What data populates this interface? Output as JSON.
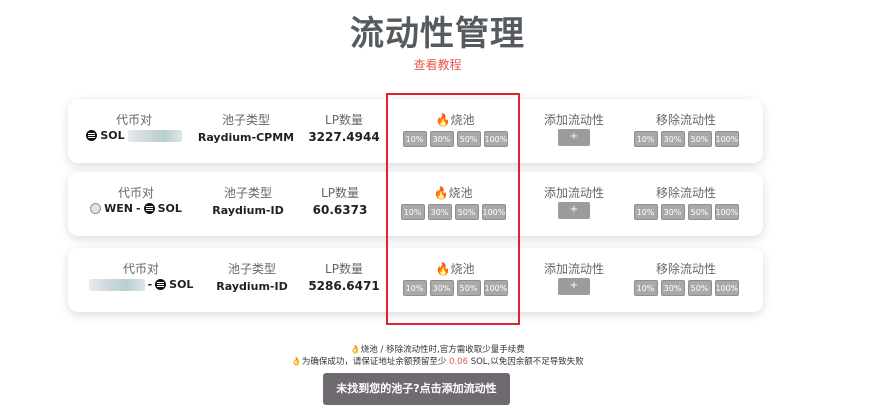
{
  "header": {
    "title": "流动性管理",
    "tutorial_link": "查看教程"
  },
  "labels": {
    "pair": "代币对",
    "pool_type": "池子类型",
    "lp_amount": "LP数量",
    "burn_pool": "烧池",
    "add_liquidity": "添加流动性",
    "remove_liquidity": "移除流动性",
    "add_symbol": "+",
    "dash": "-"
  },
  "percent_options": [
    "10%",
    "30%",
    "50%",
    "100%"
  ],
  "pools": [
    {
      "token_a": "SOL",
      "token_b": "",
      "pool_type": "Raydium-CPMM",
      "lp_amount": "3227.4944"
    },
    {
      "token_a": "WEN",
      "token_b": "SOL",
      "pool_type": "Raydium-ID",
      "lp_amount": "60.6373"
    },
    {
      "token_a": "",
      "token_b": "SOL",
      "pool_type": "Raydium-ID",
      "lp_amount": "5286.6471"
    }
  ],
  "notes": {
    "line1": "烧池 / 移除流动性时,官方需收取少量手续费",
    "line2_prefix": "为确保成功，请保证地址余额预留至少",
    "line2_amount": "0.06",
    "line2_suffix": "SOL,以免因余额不足导致失败"
  },
  "cta_label": "未找到您的池子?点击添加流动性",
  "colors": {
    "highlight": "#e0232d",
    "link": "#e8584f",
    "title": "#555a5e",
    "cta_bg": "#6f6a70"
  },
  "icons": {
    "fire": "🔥",
    "hand": "👌"
  }
}
